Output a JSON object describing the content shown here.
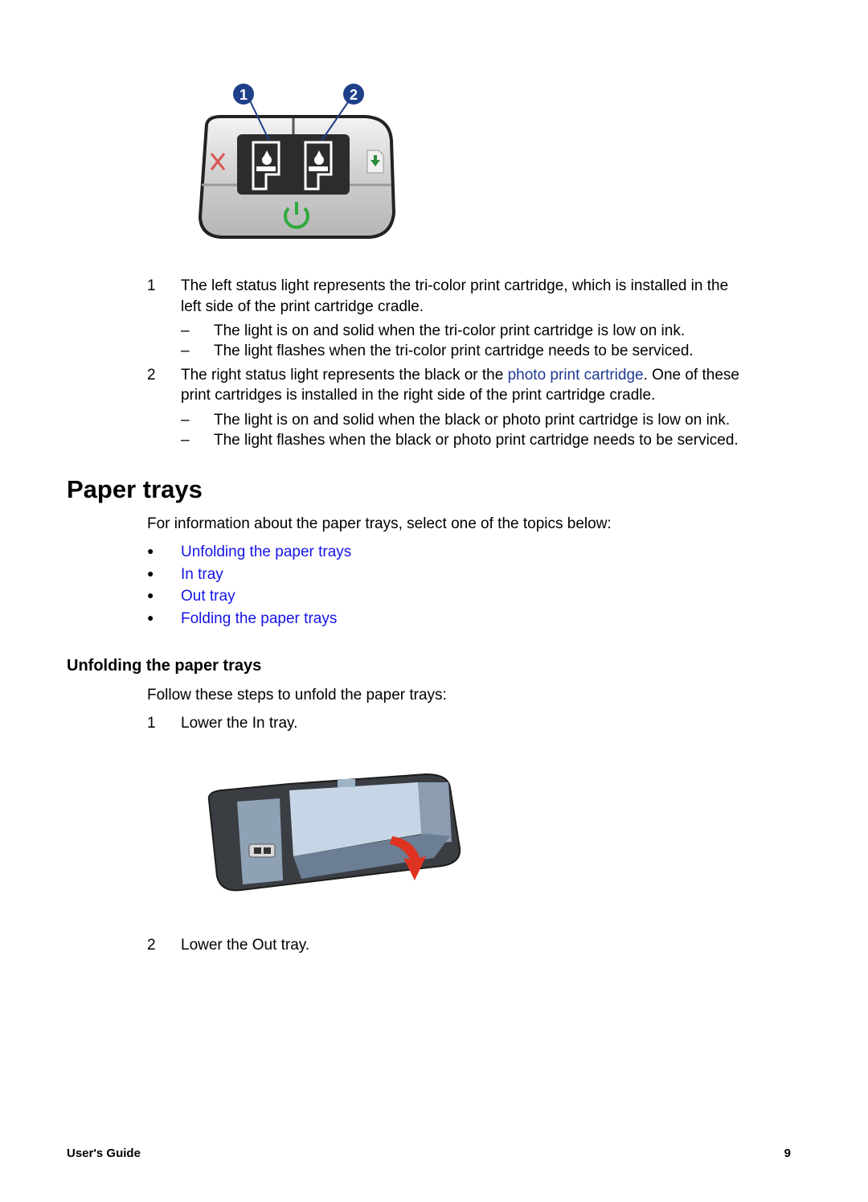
{
  "figure1": {
    "callouts": [
      "1",
      "2"
    ],
    "icons": [
      "cancel-icon",
      "tricolor-cartridge-light-icon",
      "black-photo-cartridge-light-icon",
      "resume-icon",
      "power-icon"
    ]
  },
  "list1": [
    {
      "num": "1",
      "line1": "The left status light represents the tri-color print cartridge, which is installed in the",
      "line2": "left side of the print cartridge cradle.",
      "subitems": [
        "The light is on and solid when the tri-color print cartridge is low on ink.",
        "The light flashes when the tri-color print cartridge needs to be serviced."
      ]
    },
    {
      "num": "2",
      "line1_pre": "The right status light represents the black or the ",
      "line1_link": "photo print cartridge",
      "line1_post": ". One of these",
      "line2": "print cartridges is installed in the right side of the print cartridge cradle.",
      "subitems": [
        "The light is on and solid when the black or photo print cartridge is low on ink.",
        "The light flashes when the black or photo print cartridge needs to be serviced."
      ]
    }
  ],
  "dash": "–",
  "section": {
    "title": "Paper trays",
    "intro": "For information about the paper trays, select one of the topics below:",
    "links": [
      "Unfolding the paper trays",
      "In tray",
      "Out tray",
      "Folding the paper trays"
    ],
    "bullet": "●"
  },
  "subsection": {
    "title": "Unfolding the paper trays",
    "intro": "Follow these steps to unfold the paper trays:",
    "steps": [
      {
        "num": "1",
        "text": "Lower the In tray."
      },
      {
        "num": "2",
        "text": "Lower the Out tray."
      }
    ]
  },
  "footer": {
    "left": "User's Guide",
    "page": "9"
  },
  "colors": {
    "link": "#1414e6",
    "inline_link": "#1f3a93"
  }
}
